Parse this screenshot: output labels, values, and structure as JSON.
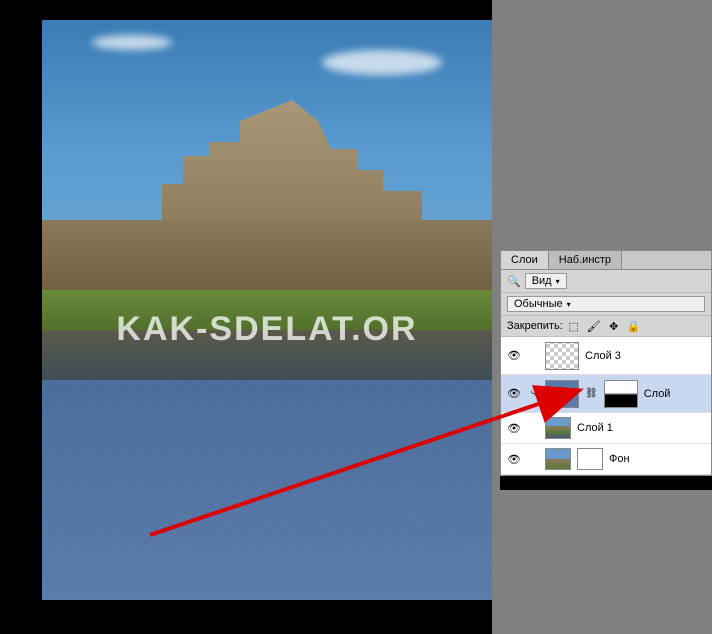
{
  "watermark": "KAK-SDELAT.OR",
  "panel": {
    "tabs": {
      "layers": "Слои",
      "toolsets": "Наб.инстр"
    },
    "filter": {
      "label": "Вид",
      "search_icon": "search-icon"
    },
    "blend_mode": "Обычные",
    "lock_label": "Закрепить:"
  },
  "layers": [
    {
      "name": "Слой 3",
      "visible": true,
      "selected": false,
      "thumb": "checker",
      "clipped": false
    },
    {
      "name": "Слой",
      "visible": true,
      "selected": true,
      "thumb": "blue",
      "mask": true,
      "clipped": true
    },
    {
      "name": "Слой 1",
      "visible": true,
      "selected": false,
      "thumb": "castle-thumb",
      "clipped": false,
      "small": true
    },
    {
      "name": "Фон",
      "visible": true,
      "selected": false,
      "thumb": "full-thumb",
      "secondary": "white",
      "clipped": false,
      "small": true
    }
  ]
}
